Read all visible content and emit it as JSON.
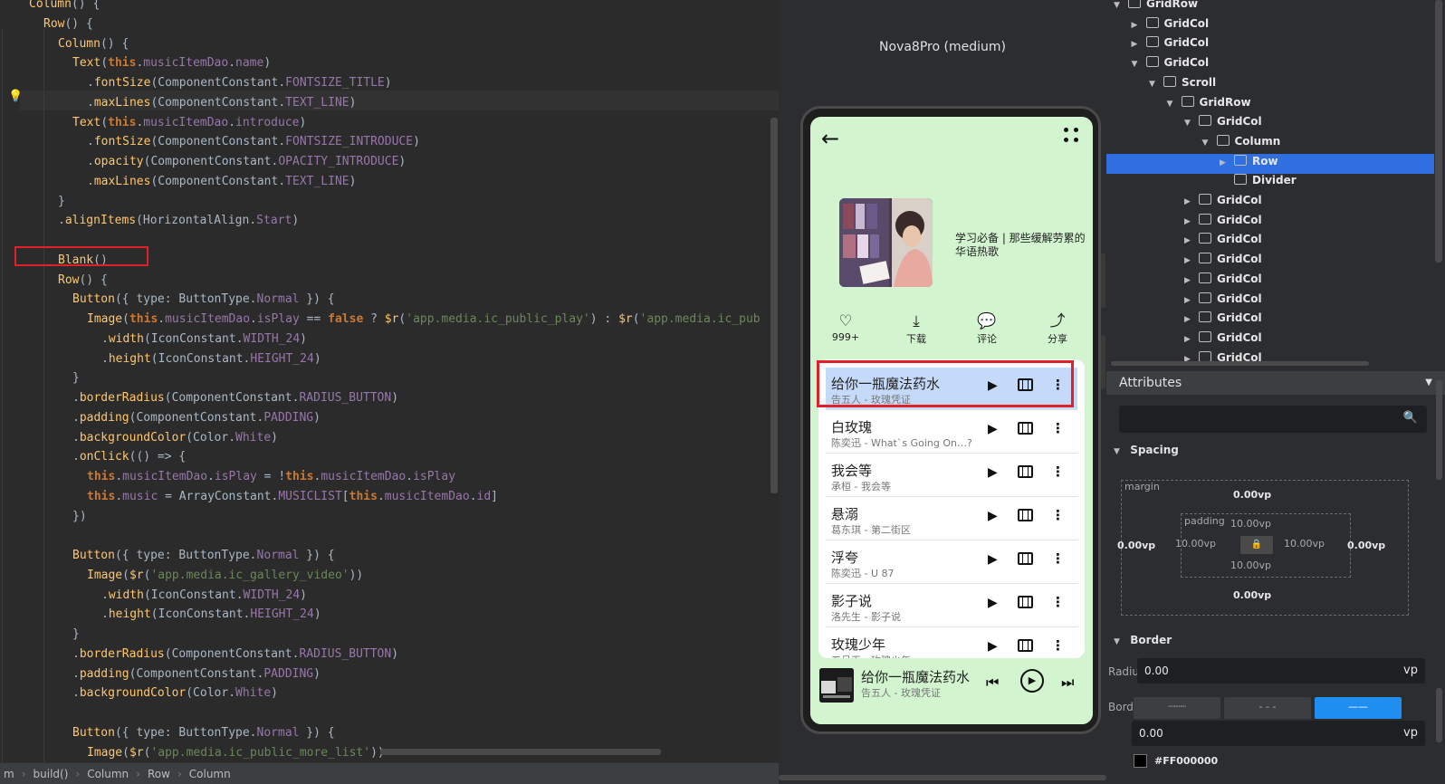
{
  "editor": {
    "lines": [
      {
        "indent": 2,
        "html": "<span class='call'>Column</span>() {"
      },
      {
        "indent": 3,
        "html": "<span class='call'>Row</span>() {"
      },
      {
        "indent": 4,
        "html": "<span class='call'>Column</span>() {"
      },
      {
        "indent": 5,
        "html": "<span class='call'>Text</span>(<span class='kw'>this</span>.<span class='prop'>musicItemDao</span>.<span class='prop'>name</span>)"
      },
      {
        "indent": 6,
        "html": ".<span class='call'>fontSize</span>(ComponentConstant.<span class='prop'>FONTSIZE_TITLE</span>)"
      },
      {
        "indent": 6,
        "html": ".<span class='call'>maxLines</span>(ComponentConstant.<span class='prop'>TEXT_LINE</span>)"
      },
      {
        "indent": 5,
        "html": "<span class='call'>Text</span>(<span class='kw'>this</span>.<span class='prop'>musicItemDao</span>.<span class='prop'>introduce</span>)"
      },
      {
        "indent": 6,
        "html": ".<span class='call'>fontSize</span>(ComponentConstant.<span class='prop'>FONTSIZE_INTRODUCE</span>)"
      },
      {
        "indent": 6,
        "html": ".<span class='call'>opacity</span>(ComponentConstant.<span class='prop'>OPACITY_INTRODUCE</span>)"
      },
      {
        "indent": 6,
        "html": ".<span class='call'>maxLines</span>(ComponentConstant.<span class='prop'>TEXT_LINE</span>)"
      },
      {
        "indent": 4,
        "html": "}"
      },
      {
        "indent": 4,
        "html": ".<span class='call'>alignItems</span>(HorizontalAlign.<span class='prop'>Start</span>)"
      },
      {
        "indent": 0,
        "html": ""
      },
      {
        "indent": 4,
        "html": "<span class='call'>Blank</span>()"
      },
      {
        "indent": 4,
        "html": "<span class='call'>Row</span>() {"
      },
      {
        "indent": 5,
        "html": "<span class='call'>Button</span>({ type: ButtonType.<span class='prop'>Normal</span> }) {"
      },
      {
        "indent": 6,
        "html": "<span class='call'>Image</span>(<span class='kw'>this</span>.<span class='prop'>musicItemDao</span>.<span class='prop'>isPlay</span> == <span class='kw'>false</span> ? <span class='call'>$r</span>(<span class='str'>'app.media.ic_public_play'</span>) : <span class='call'>$r</span>(<span class='str'>'app.media.ic_pub</span>"
      },
      {
        "indent": 7,
        "html": ".<span class='call'>width</span>(IconConstant.<span class='prop'>WIDTH_24</span>)"
      },
      {
        "indent": 7,
        "html": ".<span class='call'>height</span>(IconConstant.<span class='prop'>HEIGHT_24</span>)"
      },
      {
        "indent": 5,
        "html": "}"
      },
      {
        "indent": 5,
        "html": ".<span class='call'>borderRadius</span>(ComponentConstant.<span class='prop'>RADIUS_BUTTON</span>)"
      },
      {
        "indent": 5,
        "html": ".<span class='call'>padding</span>(ComponentConstant.<span class='prop'>PADDING</span>)"
      },
      {
        "indent": 5,
        "html": ".<span class='call'>backgroundColor</span>(Color.<span class='prop'>White</span>)"
      },
      {
        "indent": 5,
        "html": ".<span class='call'>onClick</span>(() => {"
      },
      {
        "indent": 6,
        "html": "<span class='kw'>this</span>.<span class='prop'>musicItemDao</span>.<span class='prop'>isPlay</span> = !<span class='kw'>this</span>.<span class='prop'>musicItemDao</span>.<span class='prop'>isPlay</span>"
      },
      {
        "indent": 6,
        "html": "<span class='kw'>this</span>.<span class='prop'>music</span> = ArrayConstant.<span class='prop'>MUSICLIST</span>[<span class='kw'>this</span>.<span class='prop'>musicItemDao</span>.<span class='prop'>id</span>]"
      },
      {
        "indent": 5,
        "html": "})"
      },
      {
        "indent": 0,
        "html": ""
      },
      {
        "indent": 5,
        "html": "<span class='call'>Button</span>({ type: ButtonType.<span class='prop'>Normal</span> }) {"
      },
      {
        "indent": 6,
        "html": "<span class='call'>Image</span>(<span class='call'>$r</span>(<span class='str'>'app.media.ic_gallery_video'</span>))"
      },
      {
        "indent": 7,
        "html": ".<span class='call'>width</span>(IconConstant.<span class='prop'>WIDTH_24</span>)"
      },
      {
        "indent": 7,
        "html": ".<span class='call'>height</span>(IconConstant.<span class='prop'>HEIGHT_24</span>)"
      },
      {
        "indent": 5,
        "html": "}"
      },
      {
        "indent": 5,
        "html": ".<span class='call'>borderRadius</span>(ComponentConstant.<span class='prop'>RADIUS_BUTTON</span>)"
      },
      {
        "indent": 5,
        "html": ".<span class='call'>padding</span>(ComponentConstant.<span class='prop'>PADDING</span>)"
      },
      {
        "indent": 5,
        "html": ".<span class='call'>backgroundColor</span>(Color.<span class='prop'>White</span>)"
      },
      {
        "indent": 0,
        "html": ""
      },
      {
        "indent": 5,
        "html": "<span class='call'>Button</span>({ type: ButtonType.<span class='prop'>Normal</span> }) {"
      },
      {
        "indent": 6,
        "html": "<span class='call'>Image</span>(<span class='call'>$r</span>(<span class='str'>'app.media.ic_public_more_list'</span>))"
      }
    ],
    "breadcrumb": [
      "m",
      "build()",
      "Column",
      "Row",
      "Column"
    ]
  },
  "preview": {
    "device_name": "Nova8Pro (medium)",
    "album_title": "学习必备 | 那些缓解劳累的华语热歌",
    "actions": [
      {
        "icon": "heart-icon",
        "glyph": "♡",
        "label": "999+"
      },
      {
        "icon": "download-icon",
        "glyph": "⤓",
        "label": "下载"
      },
      {
        "icon": "comment-icon",
        "glyph": "💬",
        "label": "评论"
      },
      {
        "icon": "share-icon",
        "glyph": "⤴",
        "label": "分享"
      }
    ],
    "songs": [
      {
        "name": "给你一瓶魔法药水",
        "sub": "告五人 - 玫瑰凭证",
        "selected": true
      },
      {
        "name": "白玫瑰",
        "sub": "陈奕迅 - What`s Going On…?",
        "selected": false
      },
      {
        "name": "我会等",
        "sub": "承桓 - 我会等",
        "selected": false
      },
      {
        "name": "悬溺",
        "sub": "葛东琪 - 第二街区",
        "selected": false
      },
      {
        "name": "浮夸",
        "sub": "陈奕迅 - U 87",
        "selected": false
      },
      {
        "name": "影子说",
        "sub": "洛先生 - 影子说",
        "selected": false
      },
      {
        "name": "玫瑰少年",
        "sub": "五月天 - 玫瑰少年",
        "selected": false
      }
    ],
    "player": {
      "title": "给你一瓶魔法药水",
      "sub": "告五人 - 玫瑰凭证"
    }
  },
  "inspector": {
    "tree": [
      {
        "label": "GridRow",
        "level": 0,
        "state": "open"
      },
      {
        "label": "GridCol",
        "level": 1,
        "state": "closed"
      },
      {
        "label": "GridCol",
        "level": 1,
        "state": "closed"
      },
      {
        "label": "GridCol",
        "level": 1,
        "state": "open"
      },
      {
        "label": "Scroll",
        "level": 2,
        "state": "open"
      },
      {
        "label": "GridRow",
        "level": 3,
        "state": "open"
      },
      {
        "label": "GridCol",
        "level": 4,
        "state": "open"
      },
      {
        "label": "Column",
        "level": 5,
        "state": "open"
      },
      {
        "label": "Row",
        "level": 6,
        "state": "closed",
        "selected": true
      },
      {
        "label": "Divider",
        "level": 6,
        "state": "none"
      },
      {
        "label": "GridCol",
        "level": 4,
        "state": "closed"
      },
      {
        "label": "GridCol",
        "level": 4,
        "state": "closed"
      },
      {
        "label": "GridCol",
        "level": 4,
        "state": "closed"
      },
      {
        "label": "GridCol",
        "level": 4,
        "state": "closed"
      },
      {
        "label": "GridCol",
        "level": 4,
        "state": "closed"
      },
      {
        "label": "GridCol",
        "level": 4,
        "state": "closed"
      },
      {
        "label": "GridCol",
        "level": 4,
        "state": "closed"
      },
      {
        "label": "GridCol",
        "level": 4,
        "state": "closed"
      },
      {
        "label": "GridCol",
        "level": 4,
        "state": "closed"
      }
    ],
    "attributes_title": "Attributes",
    "spacing": {
      "title": "Spacing",
      "margin_label": "margin",
      "margin_top": "0.00vp",
      "margin_left": "0.00vp",
      "margin_right": "0.00vp",
      "margin_bottom": "0.00vp",
      "padding_label": "padding",
      "padding_top": "10.00vp",
      "padding_left": "10.00vp",
      "padding_right": "10.00vp",
      "padding_bottom": "10.00vp"
    },
    "border": {
      "title": "Border",
      "radius_label": "Radius",
      "radius_value": "0.00",
      "radius_unit": "vp",
      "border_label": "Border",
      "styles": [
        "┈┈┈",
        "- - -",
        "——"
      ],
      "width_value": "0.00",
      "width_unit": "vp",
      "color_value": "#FF000000"
    }
  }
}
